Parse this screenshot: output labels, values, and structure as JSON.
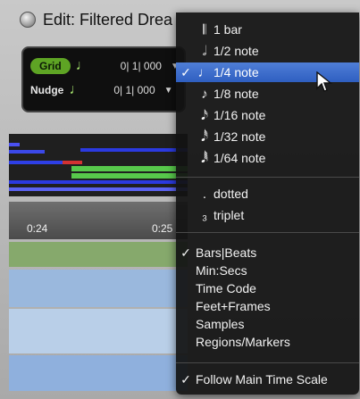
{
  "window": {
    "title": "Edit: Filtered Drea"
  },
  "grid": {
    "label": "Grid",
    "note_icon": "quarter-note-icon",
    "value": "0| 1| 000"
  },
  "nudge": {
    "label": "Nudge",
    "note_icon": "quarter-note-icon",
    "value": "0| 1| 000"
  },
  "ruler": {
    "ticks": [
      "0:24",
      "0:25"
    ]
  },
  "menu": {
    "note_values": [
      {
        "label": "1 bar",
        "icon": "bar-icon",
        "checked": false,
        "highlighted": false
      },
      {
        "label": "1/2 note",
        "icon": "half-note-icon",
        "checked": false,
        "highlighted": false
      },
      {
        "label": "1/4 note",
        "icon": "quarter-note-icon",
        "checked": true,
        "highlighted": true
      },
      {
        "label": "1/8 note",
        "icon": "eighth-note-icon",
        "checked": false,
        "highlighted": false
      },
      {
        "label": "1/16 note",
        "icon": "sixteenth-note-icon",
        "checked": false,
        "highlighted": false
      },
      {
        "label": "1/32 note",
        "icon": "thirty-second-note-icon",
        "checked": false,
        "highlighted": false
      },
      {
        "label": "1/64 note",
        "icon": "sixty-fourth-note-icon",
        "checked": false,
        "highlighted": false
      }
    ],
    "modifiers": [
      {
        "label": "dotted",
        "icon": "dot-icon"
      },
      {
        "label": "triplet",
        "icon": "triplet-icon"
      }
    ],
    "time_scales": [
      {
        "label": "Bars|Beats",
        "checked": true
      },
      {
        "label": "Min:Secs",
        "checked": false
      },
      {
        "label": "Time Code",
        "checked": false
      },
      {
        "label": "Feet+Frames",
        "checked": false
      },
      {
        "label": "Samples",
        "checked": false
      },
      {
        "label": "Regions/Markers",
        "checked": false
      }
    ],
    "follow": {
      "label": "Follow Main Time Scale",
      "checked": true
    }
  },
  "colors": {
    "grid_green": "#5ea424",
    "menu_highlight": "#3a6bd0",
    "menu_bg": "#141414"
  }
}
